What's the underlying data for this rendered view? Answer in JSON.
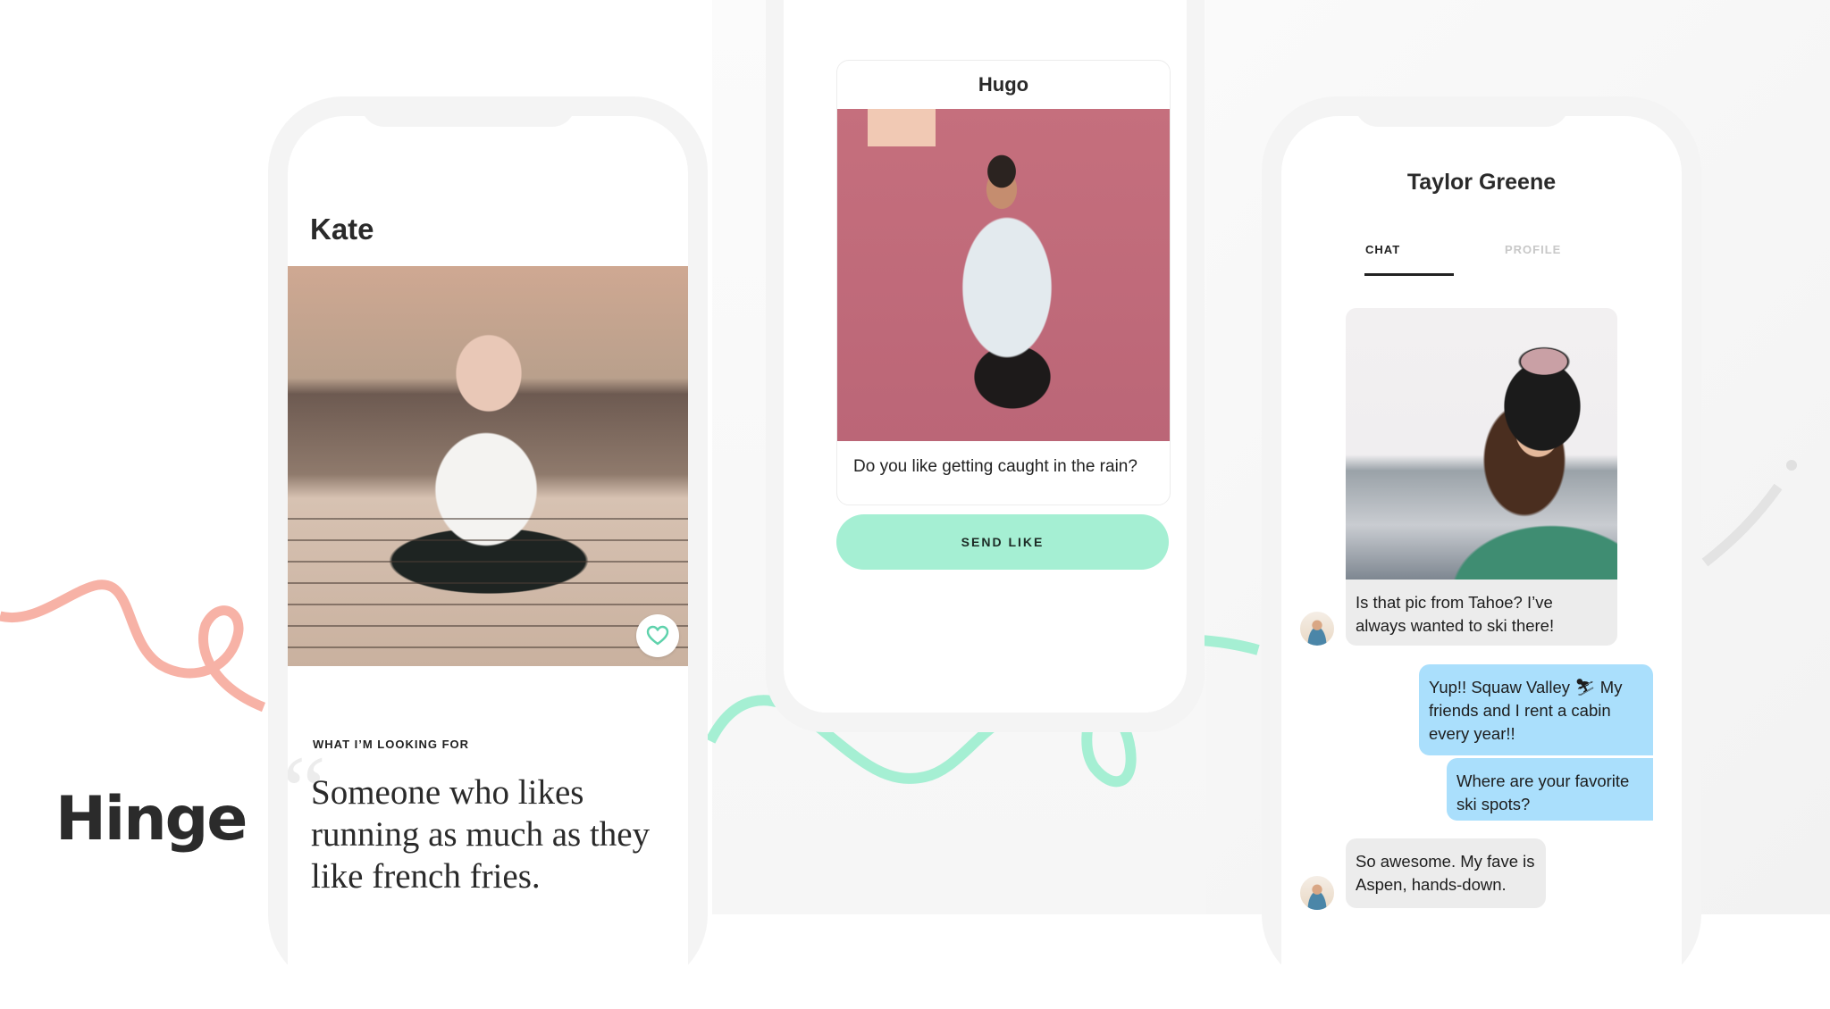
{
  "brand": {
    "logo_text": "Hinge",
    "colors": {
      "accent_mint": "#a5efd3",
      "accent_coral": "#f7b2a6",
      "chat_outgoing": "#aadffc",
      "chat_incoming": "#ececec",
      "text_dark": "#2a2a2a"
    }
  },
  "profile_screen": {
    "name": "Kate",
    "photo_alt": "Woman sitting on a dock by a lake",
    "like_icon": "heart-icon",
    "prompt_label": "WHAT I’M LOOKING FOR",
    "quote_glyph": "“",
    "prompt_answer": "Someone who likes running as much as they like french fries."
  },
  "like_screen": {
    "name": "Hugo",
    "photo_alt": "Man holding a coconut against a pink wall",
    "prompt_text": "Do you like getting caught in the rain?",
    "send_like_label": "SEND LIKE"
  },
  "chat_screen": {
    "title": "Taylor Greene",
    "tabs": [
      {
        "label": "CHAT",
        "active": true
      },
      {
        "label": "PROFILE",
        "active": false
      }
    ],
    "photo_alt": "Woman in ski goggles and green jacket",
    "messages": [
      {
        "direction": "incoming",
        "text": "Is that pic from Tahoe? I’ve always wanted to ski there!"
      },
      {
        "direction": "outgoing",
        "text": "Yup!! Squaw Valley ⛷ My friends and I rent a cabin every year!!"
      },
      {
        "direction": "outgoing",
        "text": "Where are your favorite ski spots?"
      },
      {
        "direction": "incoming",
        "text": "So awesome. My fave is Aspen, hands-down."
      }
    ]
  }
}
